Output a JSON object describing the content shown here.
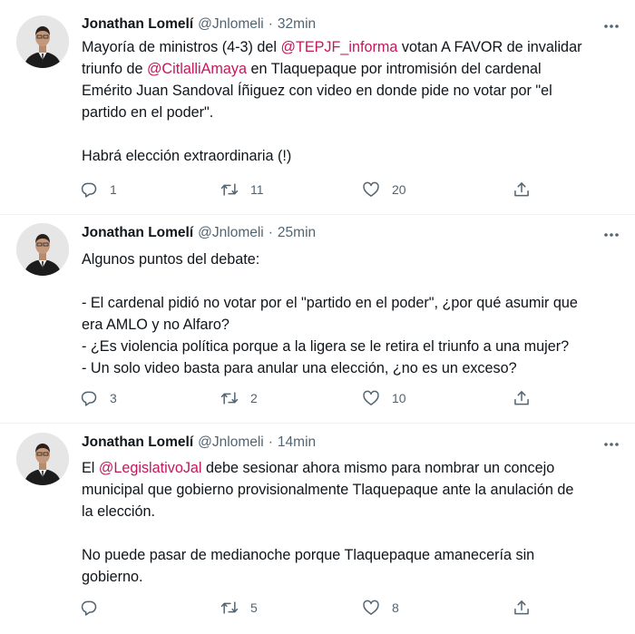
{
  "tweets": [
    {
      "name": "Jonathan Lomelí",
      "handle": "@Jnlomeli",
      "sep": "·",
      "time": "32min",
      "lines": [
        [
          {
            "t": "Mayoría de ministros (4-3) del "
          },
          {
            "t": "@TEPJF_informa",
            "m": true
          },
          {
            "t": " votan A FAVOR de invalidar"
          }
        ],
        [
          {
            "t": "triunfo de "
          },
          {
            "t": "@CitlalliAmaya",
            "m": true
          },
          {
            "t": " en Tlaquepaque por intromisión del cardenal"
          }
        ],
        [
          {
            "t": "Emérito Juan Sandoval Íñiguez con video en donde pide no votar por \"el"
          }
        ],
        [
          {
            "t": "partido en el poder\"."
          }
        ],
        [
          {
            "t": ""
          }
        ],
        [
          {
            "t": "Habrá elección extraordinaria (!)"
          }
        ]
      ],
      "replies": "1",
      "retweets": "11",
      "likes": "20"
    },
    {
      "name": "Jonathan Lomelí",
      "handle": "@Jnlomeli",
      "sep": "·",
      "time": "25min",
      "lines": [
        [
          {
            "t": "Algunos puntos del debate:"
          }
        ],
        [
          {
            "t": ""
          }
        ],
        [
          {
            "t": "- El cardenal pidió no votar por el \"partido en el poder\", ¿por qué asumir que"
          }
        ],
        [
          {
            "t": "era AMLO y no Alfaro?"
          }
        ],
        [
          {
            "t": "- ¿Es violencia política porque a la ligera se le retira el triunfo a una mujer?"
          }
        ],
        [
          {
            "t": "- Un solo video basta para anular una elección, ¿no es un exceso?"
          }
        ]
      ],
      "replies": "3",
      "retweets": "2",
      "likes": "10"
    },
    {
      "name": "Jonathan Lomelí",
      "handle": "@Jnlomeli",
      "sep": "·",
      "time": "14min",
      "lines": [
        [
          {
            "t": "El "
          },
          {
            "t": "@LegislativoJal",
            "m": true
          },
          {
            "t": " debe sesionar ahora mismo para nombrar un concejo"
          }
        ],
        [
          {
            "t": "municipal que gobierno provisionalmente Tlaquepaque ante la anulación de"
          }
        ],
        [
          {
            "t": "la elección."
          }
        ],
        [
          {
            "t": ""
          }
        ],
        [
          {
            "t": "No puede pasar de medianoche porque Tlaquepaque amanecería sin"
          }
        ],
        [
          {
            "t": "gobierno."
          }
        ]
      ],
      "replies": "",
      "retweets": "5",
      "likes": "8"
    }
  ],
  "colors": {
    "mention": "#c2185b",
    "secondary": "#536471",
    "divider": "#eff3f4"
  },
  "icons": [
    "more-icon",
    "reply-icon",
    "retweet-icon",
    "like-icon",
    "share-icon"
  ]
}
